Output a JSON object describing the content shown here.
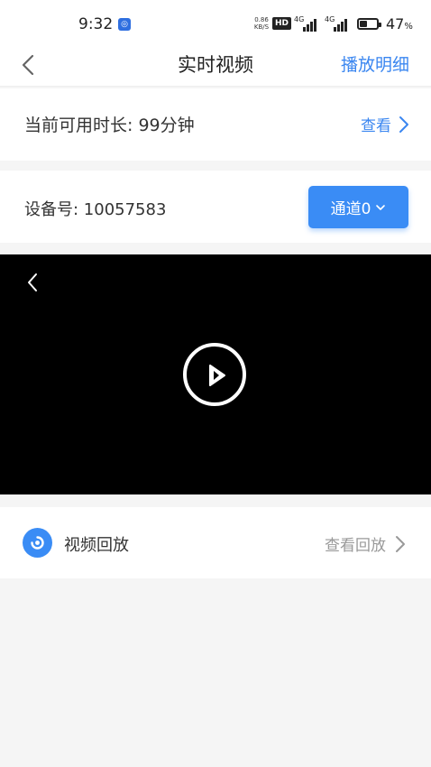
{
  "status_bar": {
    "time": "9:32",
    "net_speed_value": "0.86",
    "net_speed_unit": "KB/S",
    "hd_badge": "HD",
    "signal1_label": "4G",
    "signal2_label": "4G",
    "battery_percent": "47",
    "battery_unit": "%",
    "battery_level": 0.47
  },
  "header": {
    "title": "实时视频",
    "right_action": "播放明细"
  },
  "duration": {
    "label": "当前可用时长: 99分钟",
    "link": "查看"
  },
  "device": {
    "label": "设备号: 10057583",
    "channel_button": "通道0"
  },
  "playback": {
    "label": "视频回放",
    "link": "查看回放"
  },
  "colors": {
    "accent": "#3a8cf5",
    "link": "#3a86f0",
    "player_bg": "#000000",
    "page_bg": "#f5f5f5"
  },
  "icons": {
    "back": "chevron-left-icon",
    "forward": "chevron-right-icon",
    "dropdown": "chevron-down-icon",
    "play": "play-circle-icon",
    "playback": "playback-icon"
  }
}
